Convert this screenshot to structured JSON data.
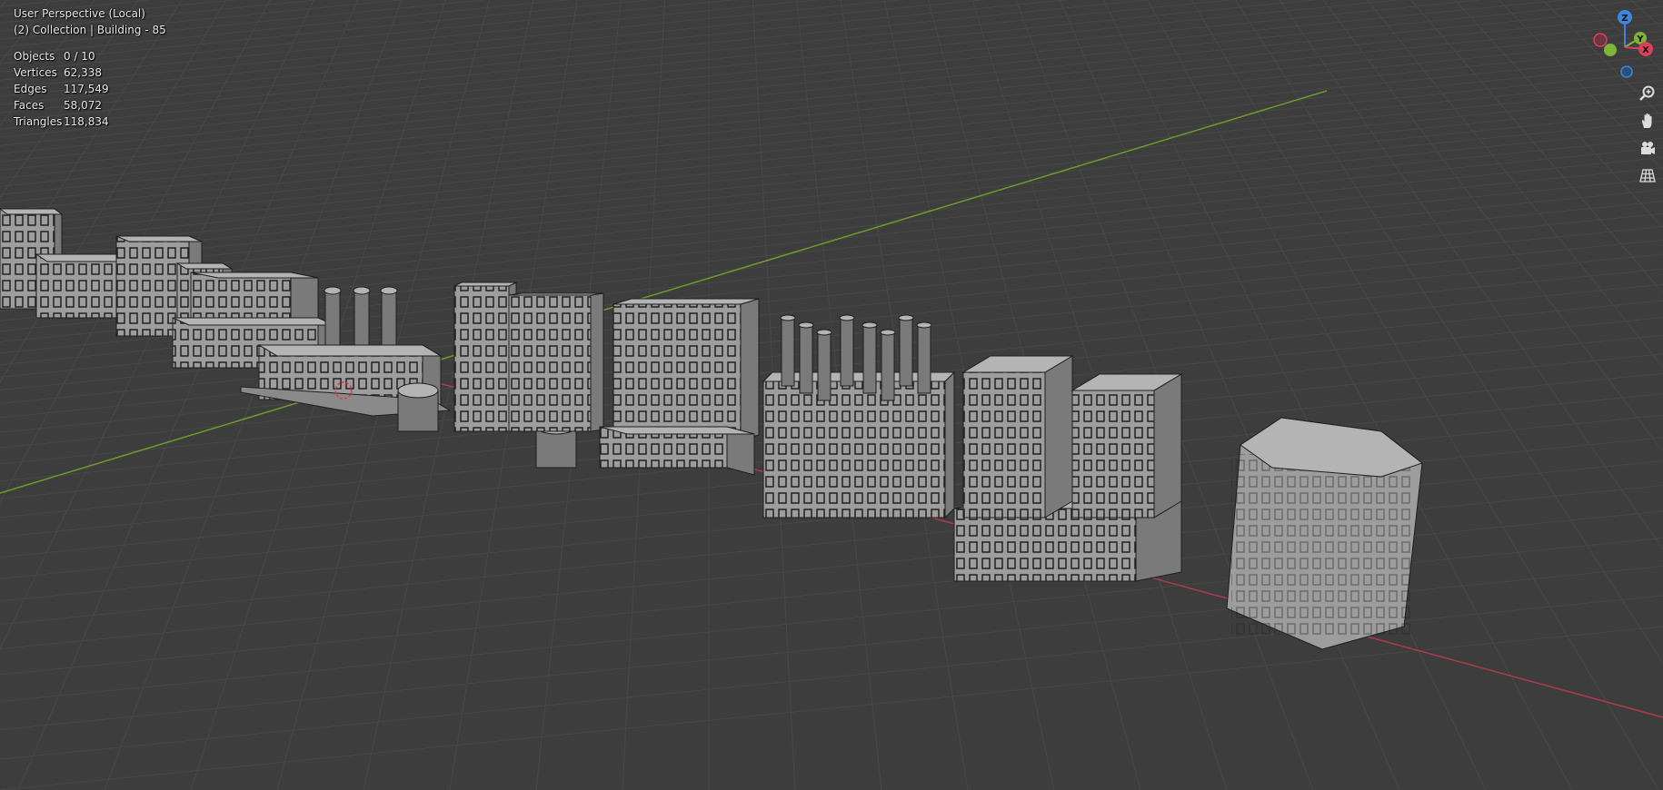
{
  "viewport": {
    "view_name": "User Perspective (Local)",
    "collection_label": "(2) Collection | Building - 85"
  },
  "stats": [
    {
      "label": "Objects",
      "value": "0 / 10"
    },
    {
      "label": "Vertices",
      "value": "62,338"
    },
    {
      "label": "Edges",
      "value": "117,549"
    },
    {
      "label": "Faces",
      "value": "58,072"
    },
    {
      "label": "Triangles",
      "value": "118,834"
    }
  ],
  "gizmo": {
    "z_label": "Z",
    "y_label": "Y",
    "x_label": "X",
    "colors": {
      "x": "#d9405a",
      "y": "#7fb43a",
      "z": "#3d85d8"
    }
  },
  "tools": [
    {
      "name": "zoom-icon"
    },
    {
      "name": "pan-hand-icon"
    },
    {
      "name": "camera-view-icon"
    },
    {
      "name": "ortho-grid-icon"
    }
  ],
  "colors": {
    "background": "#3d3d3d",
    "grid": "#484848",
    "x_axis": "#b03a4c",
    "y_axis": "#6f9a2c",
    "building_face": "#9d9d9d",
    "building_top": "#b4b4b4",
    "building_side": "#7a7a7a"
  }
}
